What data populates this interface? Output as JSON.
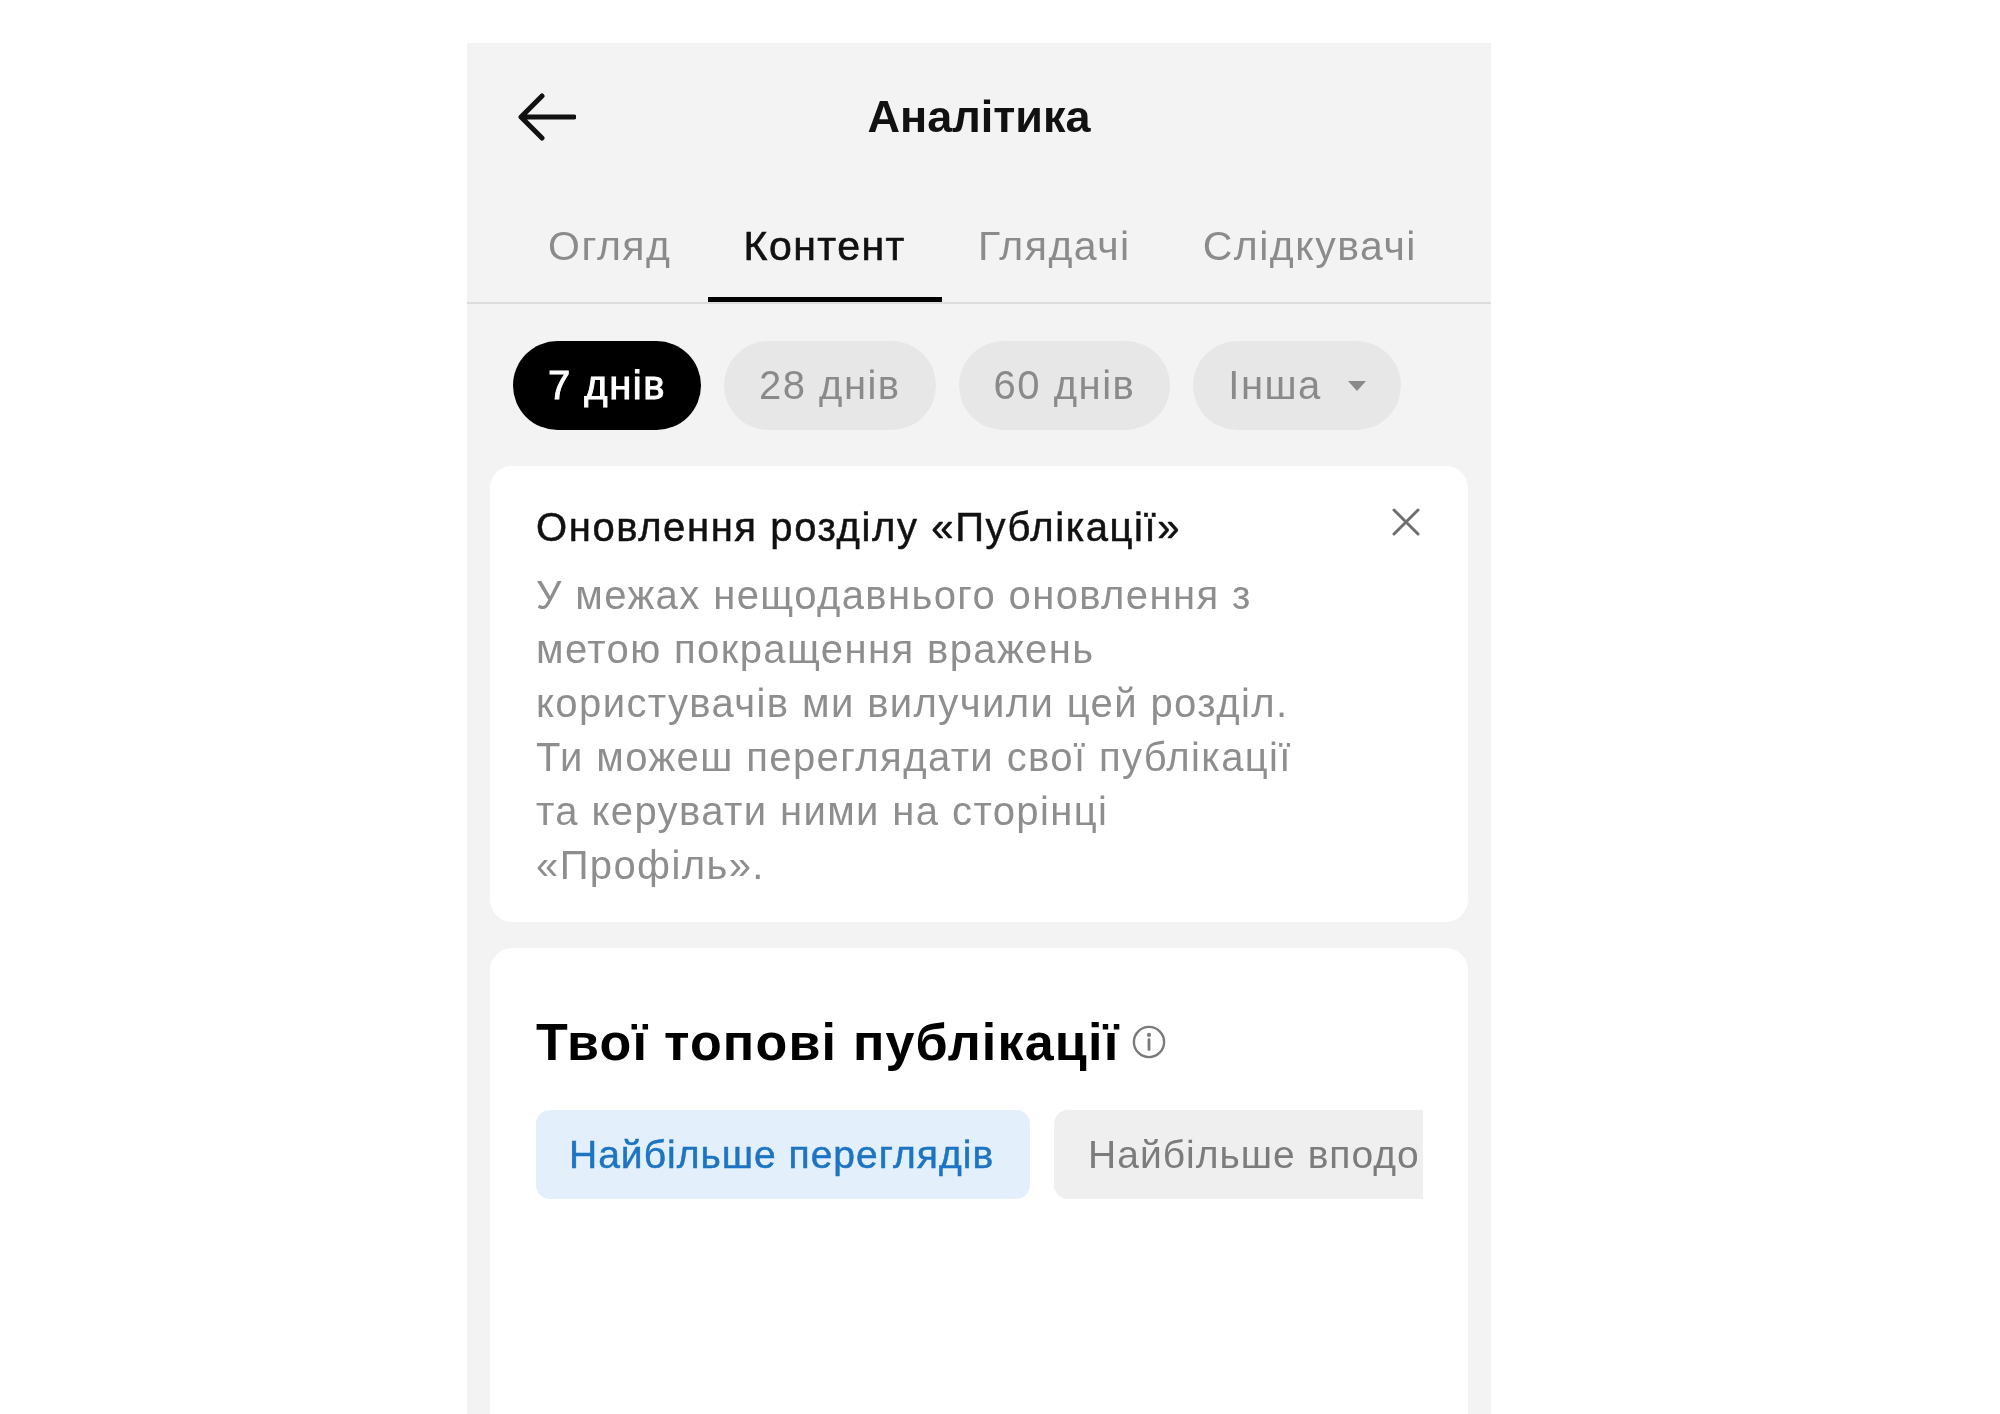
{
  "header": {
    "title": "Аналітика"
  },
  "tabs": [
    {
      "label": "Огляд",
      "selected": false
    },
    {
      "label": "Контент",
      "selected": true
    },
    {
      "label": "Глядачі",
      "selected": false
    },
    {
      "label": "Слідкувачі",
      "selected": false
    }
  ],
  "period_filters": [
    {
      "label": "7 днів",
      "selected": true,
      "dropdown": false
    },
    {
      "label": "28 днів",
      "selected": false,
      "dropdown": false
    },
    {
      "label": "60 днів",
      "selected": false,
      "dropdown": false
    },
    {
      "label": "Інша",
      "selected": false,
      "dropdown": true
    }
  ],
  "notice": {
    "title": "Оновлення розділу «Публікації»",
    "body": "У межах нещодавнього оновлення з метою покращення вражень користувачів ми вилучили цей розділ. Ти можеш переглядати свої публікації та керувати ними на сторінці «Профіль».",
    "dismissible": true
  },
  "top_posts": {
    "title": "Твої топові публікації",
    "sort_options": [
      {
        "label": "Найбільше переглядів",
        "selected": true
      },
      {
        "label": "Найбільше вподо",
        "selected": false
      }
    ]
  }
}
